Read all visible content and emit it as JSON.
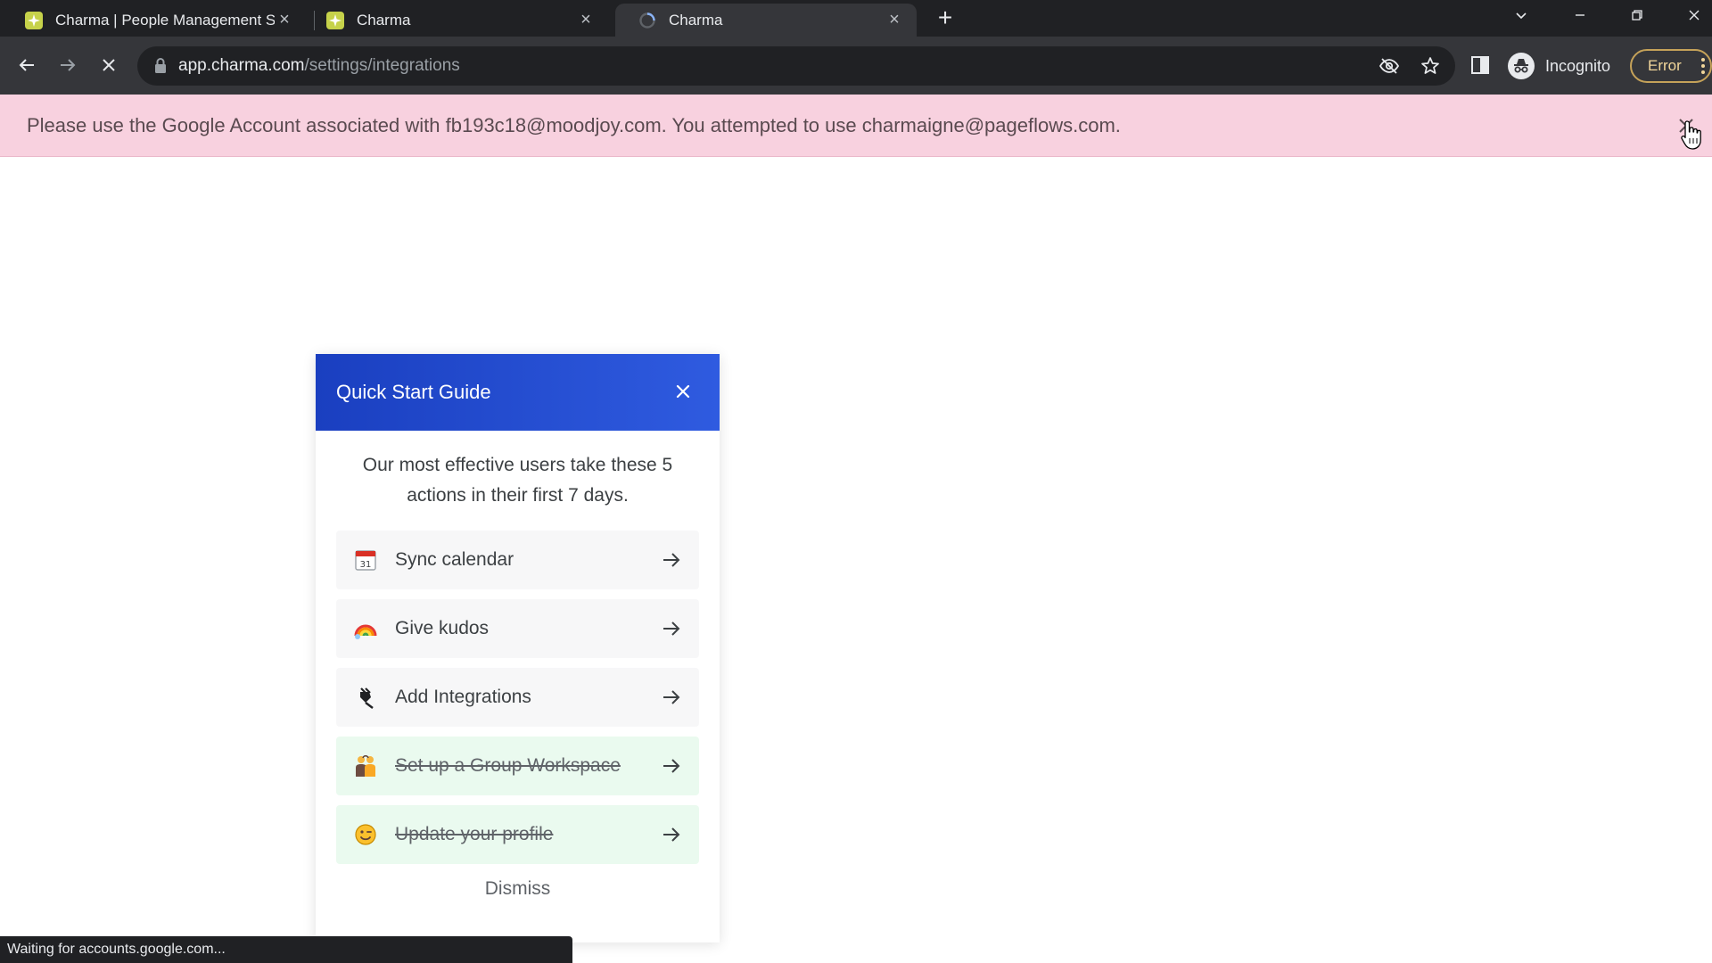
{
  "browser": {
    "tabs": [
      {
        "title": "Charma | People Management S",
        "favicon": "charma-icon",
        "active": false
      },
      {
        "title": "Charma",
        "favicon": "charma-icon",
        "active": false
      },
      {
        "title": "Charma",
        "favicon": "loading-spinner-icon",
        "active": true
      }
    ],
    "url": {
      "host": "app.charma.com",
      "path": "/settings/integrations"
    },
    "profile_label": "Incognito",
    "error_label": "Error"
  },
  "banner": {
    "message": "Please use the Google Account associated with fb193c18@moodjoy.com. You attempted to use charmaigne@pageflows.com."
  },
  "quick_start": {
    "title": "Quick Start Guide",
    "intro": "Our most effective users take these 5 actions in their first 7 days.",
    "items": [
      {
        "label": "Sync calendar",
        "icon": "calendar-icon",
        "completed": false
      },
      {
        "label": "Give kudos",
        "icon": "rainbow-icon",
        "completed": false
      },
      {
        "label": "Add Integrations",
        "icon": "plug-icon",
        "completed": false
      },
      {
        "label": "Set up a Group Workspace",
        "icon": "group-people-icon",
        "completed": true
      },
      {
        "label": "Update your profile",
        "icon": "winking-face-icon",
        "completed": true
      }
    ],
    "dismiss_label": "Dismiss"
  },
  "status_bar": {
    "text": "Waiting for accounts.google.com..."
  },
  "colors": {
    "banner_bg": "#f8d1df",
    "card_header": "#2a52d8",
    "completed_item_bg": "#eafaef"
  }
}
